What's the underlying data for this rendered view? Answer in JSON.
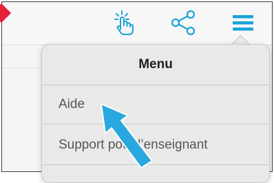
{
  "toolbar": {
    "icons": [
      "tap-gesture-icon",
      "share-icon",
      "hamburger-menu-icon"
    ],
    "accent_color": "#1aa3d9"
  },
  "menu": {
    "title": "Menu",
    "items": [
      {
        "label": "Aide"
      },
      {
        "label": "Support pour l’enseignant"
      }
    ]
  },
  "annotation": {
    "arrow_color": "#29a8df",
    "marker_color": "#e8213a"
  }
}
